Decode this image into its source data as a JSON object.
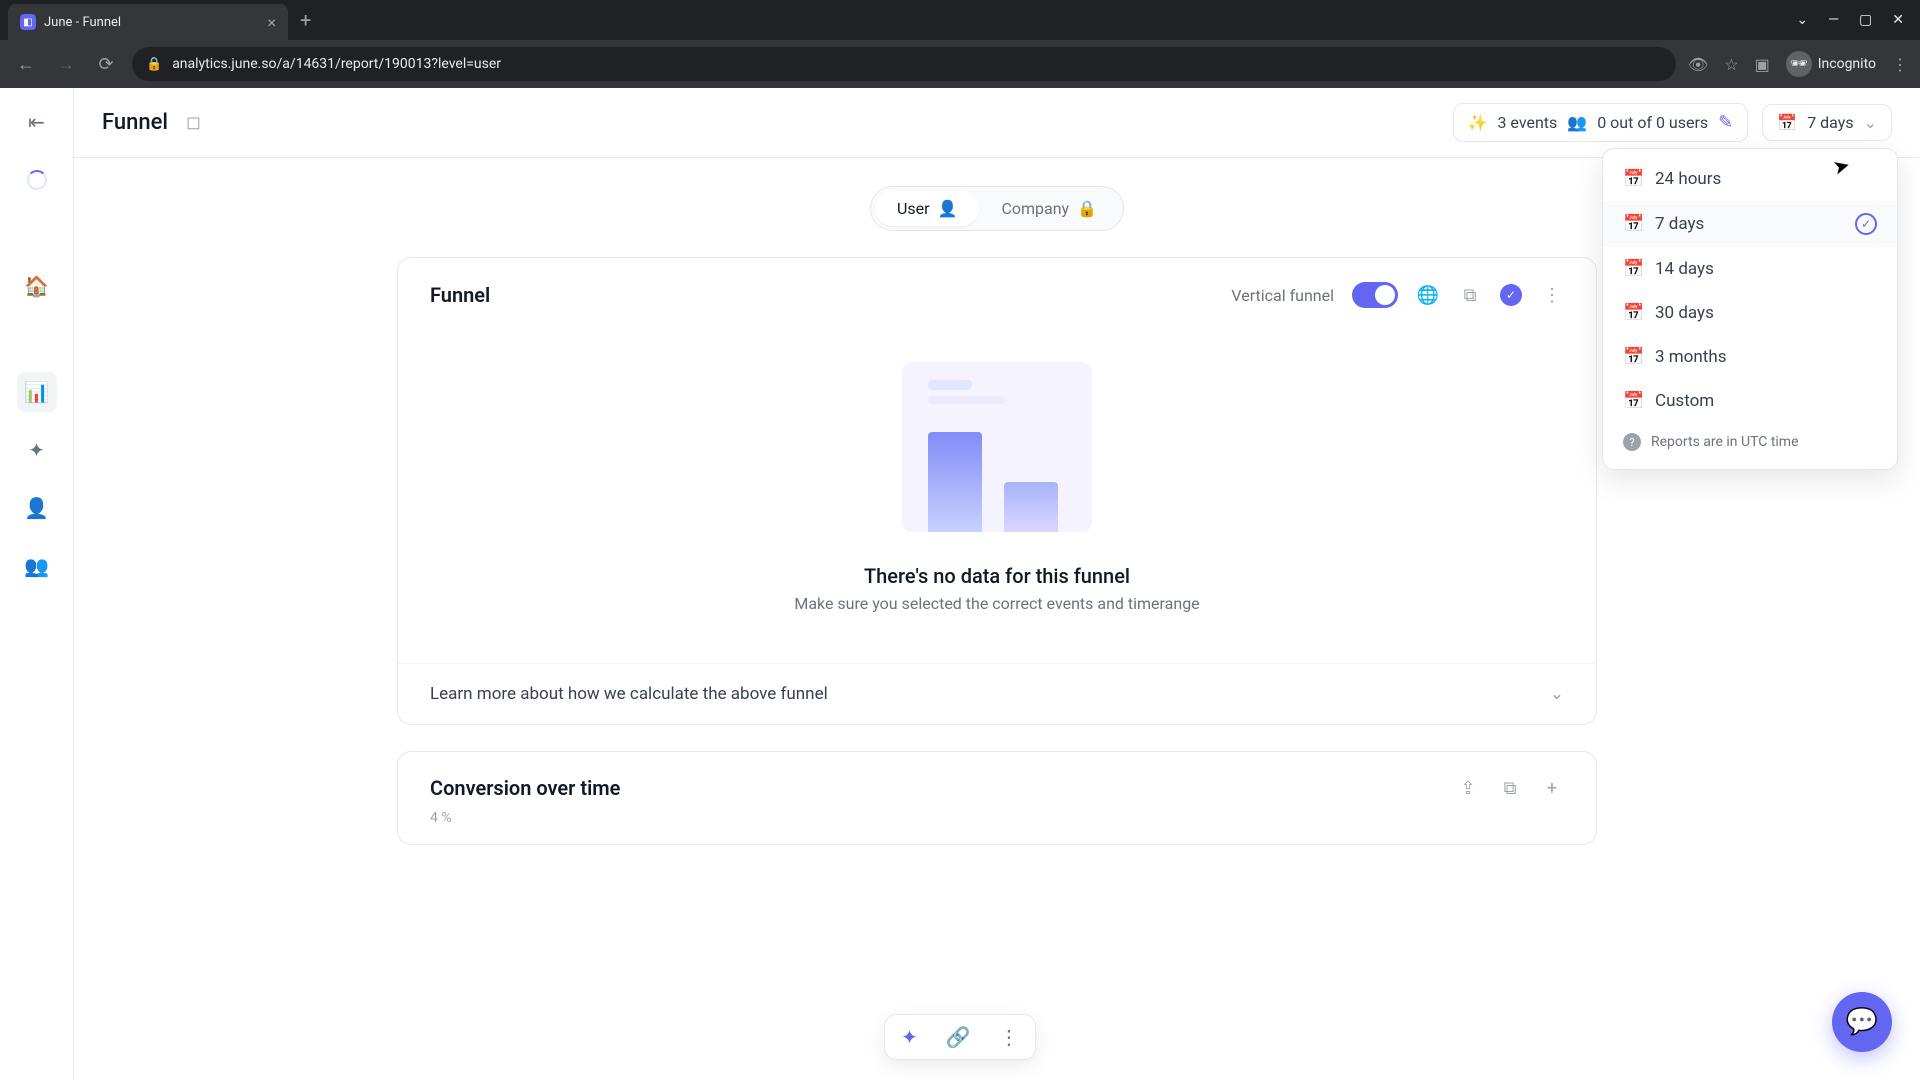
{
  "browser": {
    "tab_title": "June - Funnel",
    "url": "analytics.june.so/a/14631/report/190013?level=user",
    "profile": "Incognito"
  },
  "topbar": {
    "title": "Funnel",
    "events_label": "3 events",
    "users_label": "0 out of 0 users",
    "timerange_label": "7 days"
  },
  "level_toggle": {
    "user": "User",
    "company": "Company"
  },
  "funnel_card": {
    "title": "Funnel",
    "vertical_label": "Vertical funnel",
    "empty_title": "There's no data for this funnel",
    "empty_sub": "Make sure you selected the correct events and timerange",
    "learn_more": "Learn more about how we calculate the above funnel"
  },
  "conversion_card": {
    "title": "Conversion over time",
    "yaxis": "4 %"
  },
  "dropdown": {
    "items": [
      "24 hours",
      "7 days",
      "14 days",
      "30 days",
      "3 months",
      "Custom"
    ],
    "selected_index": 1,
    "footer": "Reports are in UTC time"
  }
}
